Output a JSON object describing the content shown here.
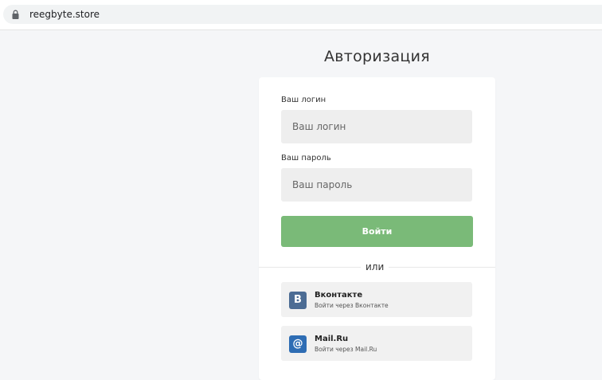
{
  "browser": {
    "url": "reegbyte.store"
  },
  "page": {
    "title": "Авторизация"
  },
  "form": {
    "login_label": "Ваш логин",
    "login_placeholder": "Ваш логин",
    "password_label": "Ваш пароль",
    "password_placeholder": "Ваш пароль",
    "submit_label": "Войти",
    "divider_text": "или"
  },
  "social": [
    {
      "name": "Вконтакте",
      "subtitle": "Войти через Вконтакте",
      "icon": "vk-icon",
      "glyph": "В",
      "color": "#4c6c94"
    },
    {
      "name": "Mail.Ru",
      "subtitle": "Войти через Mail.Ru",
      "icon": "mailru-icon",
      "glyph": "@",
      "color": "#2e6db4"
    }
  ],
  "colors": {
    "accent": "#7aba78",
    "background": "#f5f6f8",
    "input_bg": "#eeeeee"
  }
}
